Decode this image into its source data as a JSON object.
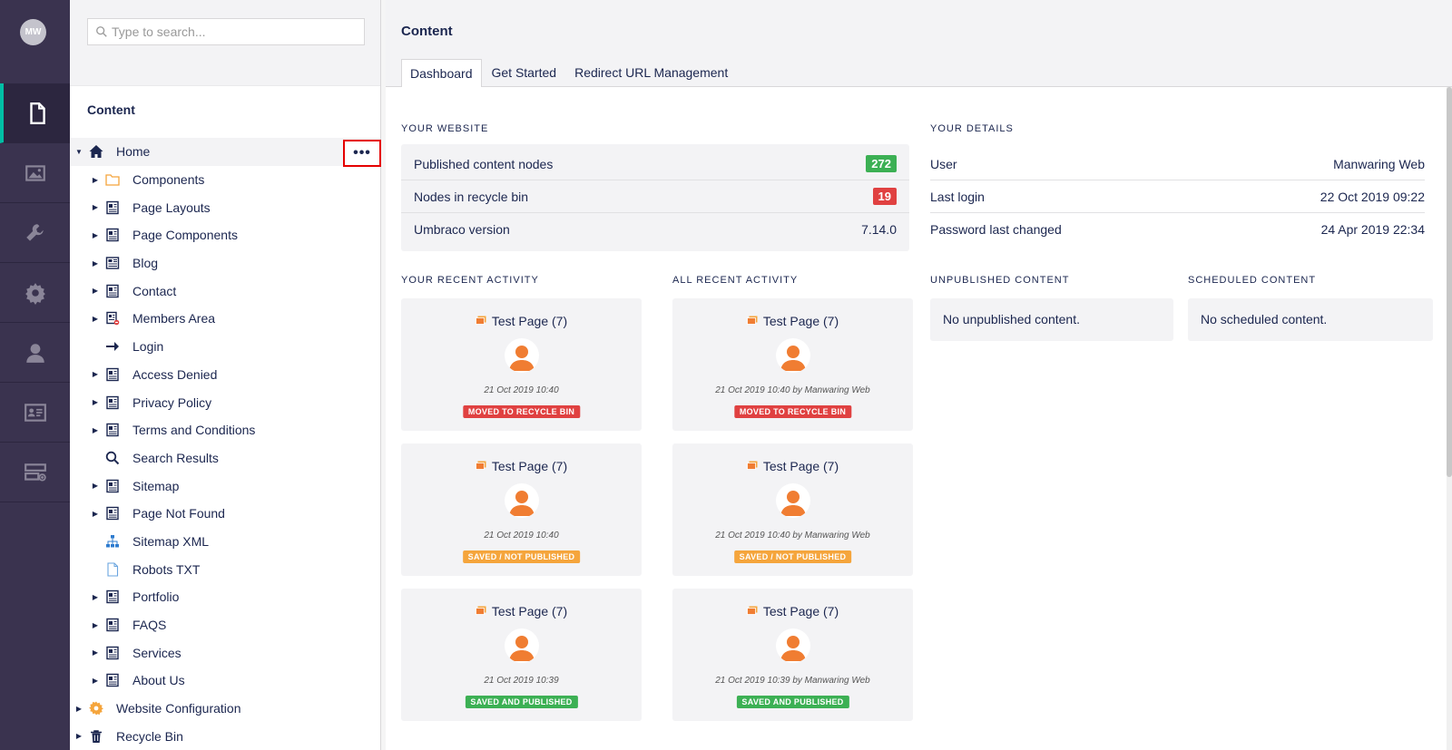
{
  "rail": {
    "avatar_initials": "MW",
    "items": [
      {
        "icon": "document-icon",
        "active": true
      },
      {
        "icon": "media-icon",
        "active": false
      },
      {
        "icon": "wrench-icon",
        "active": false
      },
      {
        "icon": "gear-icon",
        "active": false
      },
      {
        "icon": "user-icon",
        "active": false
      },
      {
        "icon": "member-card-icon",
        "active": false
      },
      {
        "icon": "forms-icon",
        "active": false
      }
    ]
  },
  "tree": {
    "search_placeholder": "Type to search...",
    "title": "Content",
    "more_label": "•••",
    "items": [
      {
        "label": "Home",
        "icon": "home-icon",
        "level": 0,
        "caret": "▼",
        "selected": true
      },
      {
        "label": "Components",
        "icon": "folder-icon",
        "level": 1,
        "caret": "▶"
      },
      {
        "label": "Page Layouts",
        "icon": "page-layout-icon",
        "level": 1,
        "caret": "▶"
      },
      {
        "label": "Page Components",
        "icon": "page-layout-icon",
        "level": 1,
        "caret": "▶"
      },
      {
        "label": "Blog",
        "icon": "newspaper-icon",
        "level": 1,
        "caret": "▶"
      },
      {
        "label": "Contact",
        "icon": "page-layout-icon",
        "level": 1,
        "caret": "▶"
      },
      {
        "label": "Members Area",
        "icon": "restricted-page-icon",
        "level": 1,
        "caret": "▶"
      },
      {
        "label": "Login",
        "icon": "arrow-right-icon",
        "level": 1,
        "caret": ""
      },
      {
        "label": "Access Denied",
        "icon": "page-layout-icon",
        "level": 1,
        "caret": "▶"
      },
      {
        "label": "Privacy Policy",
        "icon": "page-layout-icon",
        "level": 1,
        "caret": "▶"
      },
      {
        "label": "Terms and Conditions",
        "icon": "page-layout-icon",
        "level": 1,
        "caret": "▶"
      },
      {
        "label": "Search Results",
        "icon": "search-icon",
        "level": 1,
        "caret": ""
      },
      {
        "label": "Sitemap",
        "icon": "page-layout-icon",
        "level": 1,
        "caret": "▶"
      },
      {
        "label": "Page Not Found",
        "icon": "page-layout-icon",
        "level": 1,
        "caret": "▶"
      },
      {
        "label": "Sitemap XML",
        "icon": "sitemap-icon",
        "level": 1,
        "caret": ""
      },
      {
        "label": "Robots TXT",
        "icon": "file-icon",
        "level": 1,
        "caret": ""
      },
      {
        "label": "Portfolio",
        "icon": "page-layout-icon",
        "level": 1,
        "caret": "▶"
      },
      {
        "label": "FAQS",
        "icon": "page-layout-icon",
        "level": 1,
        "caret": "▶"
      },
      {
        "label": "Services",
        "icon": "page-layout-icon",
        "level": 1,
        "caret": "▶"
      },
      {
        "label": "About Us",
        "icon": "page-layout-icon",
        "level": 1,
        "caret": "▶"
      },
      {
        "label": "Website Configuration",
        "icon": "settings-cog-icon",
        "level": 0,
        "caret": "▶"
      },
      {
        "label": "Recycle Bin",
        "icon": "trash-icon",
        "level": 0,
        "caret": "▶"
      }
    ]
  },
  "main": {
    "title": "Content",
    "tabs": [
      {
        "label": "Dashboard",
        "active": true
      },
      {
        "label": "Get Started",
        "active": false
      },
      {
        "label": "Redirect URL Management",
        "active": false
      }
    ],
    "your_website": {
      "label": "YOUR WEBSITE",
      "rows": [
        {
          "key": "Published content nodes",
          "value": "272",
          "badge": "green"
        },
        {
          "key": "Nodes in recycle bin",
          "value": "19",
          "badge": "red"
        },
        {
          "key": "Umbraco version",
          "value": "7.14.0",
          "badge": ""
        }
      ]
    },
    "your_details": {
      "label": "YOUR DETAILS",
      "rows": [
        {
          "key": "User",
          "value": "Manwaring Web"
        },
        {
          "key": "Last login",
          "value": "22 Oct 2019 09:22"
        },
        {
          "key": "Password last changed",
          "value": "24 Apr 2019 22:34"
        }
      ]
    },
    "your_recent_activity": {
      "label": "YOUR RECENT ACTIVITY",
      "cards": [
        {
          "title": "Test Page (7)",
          "time": "21 Oct 2019 10:40",
          "status": "MOVED TO RECYCLE BIN",
          "status_type": "recycle"
        },
        {
          "title": "Test Page (7)",
          "time": "21 Oct 2019 10:40",
          "status": "SAVED / NOT PUBLISHED",
          "status_type": "saved"
        },
        {
          "title": "Test Page (7)",
          "time": "21 Oct 2019 10:39",
          "status": "SAVED AND PUBLISHED",
          "status_type": "published"
        }
      ]
    },
    "all_recent_activity": {
      "label": "ALL RECENT ACTIVITY",
      "cards": [
        {
          "title": "Test Page (7)",
          "time": "21 Oct 2019 10:40 by Manwaring Web",
          "status": "MOVED TO RECYCLE BIN",
          "status_type": "recycle"
        },
        {
          "title": "Test Page (7)",
          "time": "21 Oct 2019 10:40 by Manwaring Web",
          "status": "SAVED / NOT PUBLISHED",
          "status_type": "saved"
        },
        {
          "title": "Test Page (7)",
          "time": "21 Oct 2019 10:39 by Manwaring Web",
          "status": "SAVED AND PUBLISHED",
          "status_type": "published"
        }
      ]
    },
    "unpublished": {
      "label": "UNPUBLISHED CONTENT",
      "text": "No unpublished content."
    },
    "scheduled": {
      "label": "SCHEDULED CONTENT",
      "text": "No scheduled content."
    }
  },
  "colors": {
    "rail_bg": "#3a334f",
    "active_accent": "#00bfa5",
    "text": "#1b264f",
    "badge_green": "#3cb054",
    "badge_red": "#e04141",
    "status_saved": "#f5a53c",
    "avatar_orange": "#f07d32"
  }
}
